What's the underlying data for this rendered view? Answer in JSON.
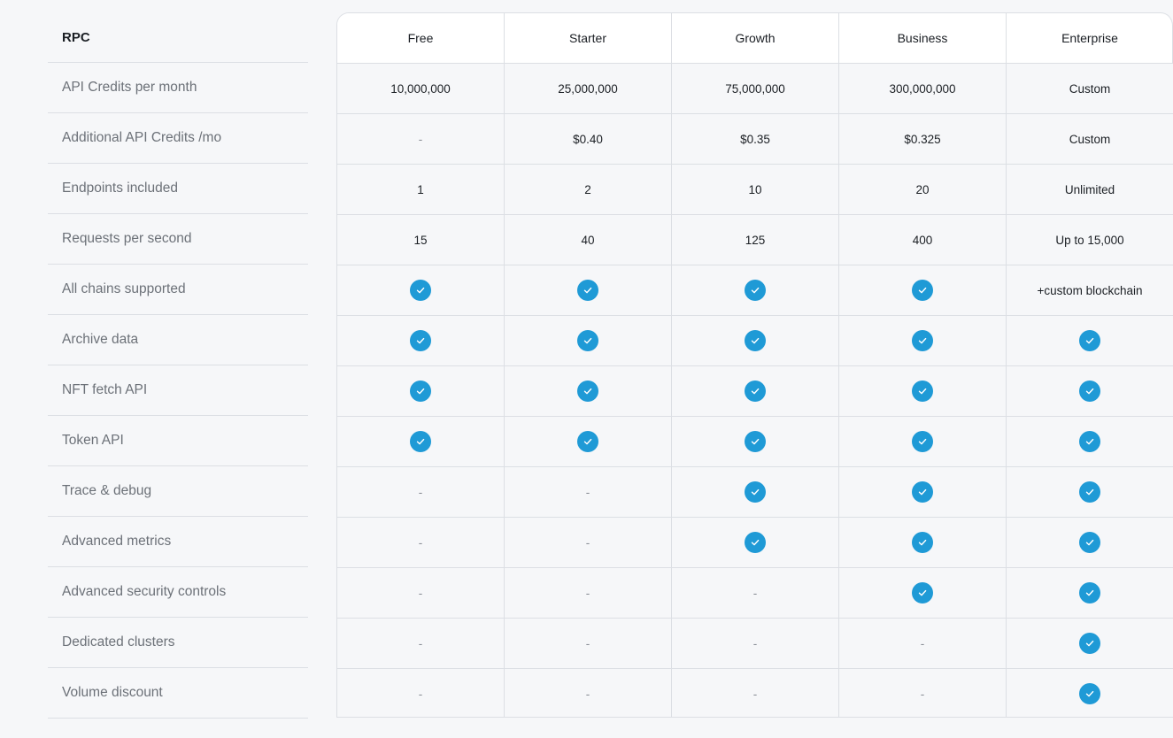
{
  "title": "RPC",
  "plans": [
    "Free",
    "Starter",
    "Growth",
    "Business",
    "Enterprise"
  ],
  "rows": [
    {
      "feature": "API Credits per month",
      "values": [
        "10,000,000",
        "25,000,000",
        "75,000,000",
        "300,000,000",
        "Custom"
      ]
    },
    {
      "feature": "Additional API Credits /mo",
      "values": [
        "-",
        "$0.40",
        "$0.35",
        "$0.325",
        "Custom"
      ]
    },
    {
      "feature": "Endpoints included",
      "values": [
        "1",
        "2",
        "10",
        "20",
        "Unlimited"
      ]
    },
    {
      "feature": "Requests per second",
      "values": [
        "15",
        "40",
        "125",
        "400",
        "Up to 15,000"
      ]
    },
    {
      "feature": "All chains supported",
      "values": [
        "check",
        "check",
        "check",
        "check",
        "+custom blockchain"
      ]
    },
    {
      "feature": "Archive data",
      "values": [
        "check",
        "check",
        "check",
        "check",
        "check"
      ]
    },
    {
      "feature": "NFT fetch API",
      "values": [
        "check",
        "check",
        "check",
        "check",
        "check"
      ]
    },
    {
      "feature": "Token API",
      "values": [
        "check",
        "check",
        "check",
        "check",
        "check"
      ]
    },
    {
      "feature": "Trace & debug",
      "values": [
        "-",
        "-",
        "check",
        "check",
        "check"
      ]
    },
    {
      "feature": "Advanced metrics",
      "values": [
        "-",
        "-",
        "check",
        "check",
        "check"
      ]
    },
    {
      "feature": "Advanced security controls",
      "values": [
        "-",
        "-",
        "-",
        "check",
        "check"
      ]
    },
    {
      "feature": "Dedicated clusters",
      "values": [
        "-",
        "-",
        "-",
        "-",
        "check"
      ]
    },
    {
      "feature": "Volume discount",
      "values": [
        "-",
        "-",
        "-",
        "-",
        "check"
      ]
    }
  ],
  "icons": {
    "included": "check-circle-icon"
  },
  "colors": {
    "check": "#1f9ad6",
    "border": "#dcdfe4",
    "background": "#f6f7f9",
    "header_bg": "#ffffff"
  }
}
